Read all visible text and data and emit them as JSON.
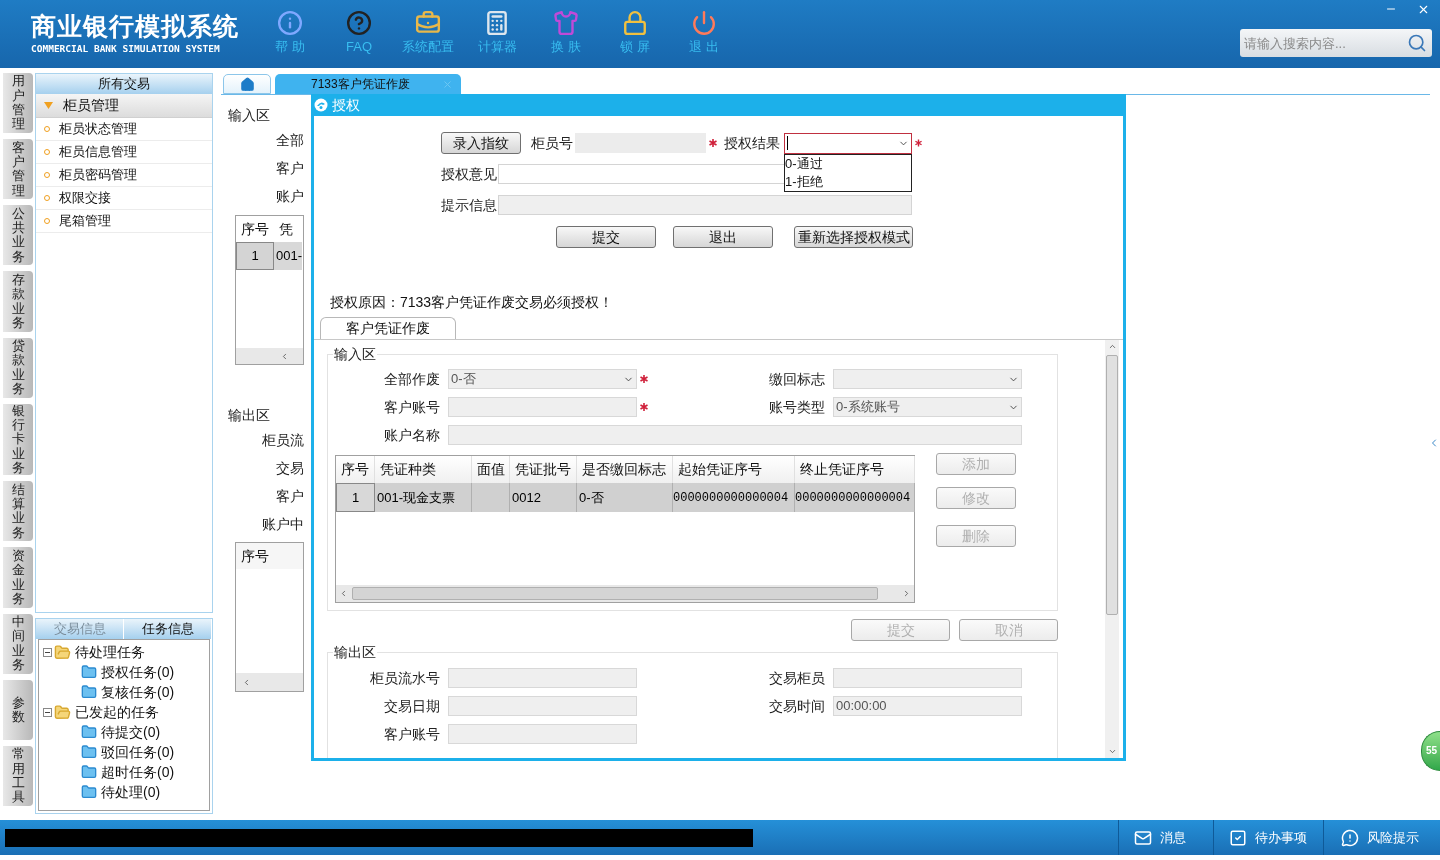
{
  "header": {
    "title": "商业银行模拟系统",
    "subtitle": "COMMERCIAL BANK SIMULATION SYSTEM",
    "toolbar": [
      {
        "kind": "help",
        "label": "帮 助"
      },
      {
        "kind": "faq",
        "label": "FAQ"
      },
      {
        "kind": "config",
        "label": "系统配置"
      },
      {
        "kind": "calculator",
        "label": "计算器"
      },
      {
        "kind": "skin",
        "label": "换 肤"
      },
      {
        "kind": "lock",
        "label": "锁 屏"
      },
      {
        "kind": "exit",
        "label": "退 出"
      }
    ],
    "search": {
      "placeholder": "请输入搜索内容..."
    }
  },
  "module_tabs": [
    "用户管理",
    "客户管理",
    "公共业务",
    "存款业务",
    "贷款业务",
    "银行卡业务",
    "结算业务",
    "资金业务",
    "中间业务",
    "参数",
    "常用工具"
  ],
  "sidebar": {
    "header": "所有交易",
    "group": {
      "label": "柜员管理",
      "expanded": true,
      "items": [
        "柜员状态管理",
        "柜员信息管理",
        "柜员密码管理",
        "权限交接",
        "尾箱管理"
      ]
    },
    "bottom_tabs": [
      {
        "label": "交易信息",
        "selected": false
      },
      {
        "label": "任务信息",
        "selected": true
      }
    ],
    "tree": [
      {
        "label": "待处理任务",
        "expanded": true,
        "children": [
          {
            "label": "授权任务(0)"
          },
          {
            "label": "复核任务(0)"
          }
        ]
      },
      {
        "label": "已发起的任务",
        "expanded": true,
        "children": [
          {
            "label": "待提交(0)"
          },
          {
            "label": "驳回任务(0)"
          },
          {
            "label": "超时任务(0)"
          },
          {
            "label": "待处理(0)"
          }
        ]
      }
    ]
  },
  "content_tabs": [
    {
      "kind": "home",
      "selected": false
    },
    {
      "kind": "page",
      "label": "7133客户凭证作废",
      "selected": true
    }
  ],
  "background_form": {
    "input_legend": "输入区",
    "input_labels": [
      "全部",
      "客户",
      "账户"
    ],
    "table": {
      "columns": [
        "序号",
        "凭"
      ],
      "rows": [
        [
          "1",
          "001-"
        ]
      ]
    },
    "output_legend": "输出区",
    "output_labels": [
      "柜员流",
      "交易",
      "客户",
      "账户中"
    ],
    "output_table": {
      "columns": [
        "序号"
      ]
    }
  },
  "dialog": {
    "title": "授权",
    "fingerprint_button": "录入指纹",
    "teller": {
      "label": "柜员号",
      "required": true
    },
    "result": {
      "label": "授权结果",
      "required": true,
      "open": true,
      "options": [
        {
          "label": "0-通过",
          "selected": false
        },
        {
          "label": "1-拒绝",
          "selected": false
        }
      ]
    },
    "opinion_label": "授权意见",
    "hint_label": "提示信息",
    "buttons": [
      "提交",
      "退出",
      "重新选择授权模式"
    ],
    "reason": "授权原因：7133客户凭证作废交易必须授权！",
    "tab": {
      "label": "客户凭证作废",
      "selected": true
    },
    "input_area": {
      "legend": "输入区",
      "fields": [
        {
          "label": "全部作废",
          "kind": "select",
          "value": "0-否",
          "required": true
        },
        {
          "label": "缴回标志",
          "kind": "select",
          "required": false
        },
        {
          "label": "客户账号",
          "kind": "text",
          "required": true
        },
        {
          "label": "账号类型",
          "kind": "select",
          "value": "0-系统账号",
          "required": false
        },
        {
          "label": "账户名称",
          "kind": "text",
          "required": false,
          "wide": true
        }
      ],
      "table": {
        "columns": [
          "序号",
          "凭证种类",
          "面值",
          "凭证批号",
          "是否缴回标志",
          "起始凭证序号",
          "终止凭证序号"
        ],
        "rows": [
          {
            "selected": true,
            "cells": [
              "1",
              "001-现金支票",
              null,
              "0012",
              "0-否",
              "0000000000000004",
              "0000000000000004"
            ]
          }
        ]
      },
      "side_buttons": [
        {
          "label": "添加",
          "disabled": true
        },
        {
          "label": "修改",
          "disabled": true
        },
        {
          "label": "删除",
          "disabled": true
        }
      ]
    },
    "actions": [
      {
        "label": "提交",
        "disabled": true
      },
      {
        "label": "取消",
        "disabled": true
      }
    ],
    "output_area": {
      "legend": "输出区",
      "fields": [
        {
          "label": "柜员流水号"
        },
        {
          "label": "交易柜员"
        },
        {
          "label": "交易日期"
        },
        {
          "label": "交易时间",
          "value": "00:00:00"
        },
        {
          "label": "客户账号"
        }
      ]
    }
  },
  "status_bar": {
    "items": [
      {
        "kind": "message",
        "label": "消息"
      },
      {
        "kind": "todo",
        "label": "待办事项"
      },
      {
        "kind": "risk",
        "label": "风险提示"
      }
    ]
  },
  "float_badge": "55"
}
